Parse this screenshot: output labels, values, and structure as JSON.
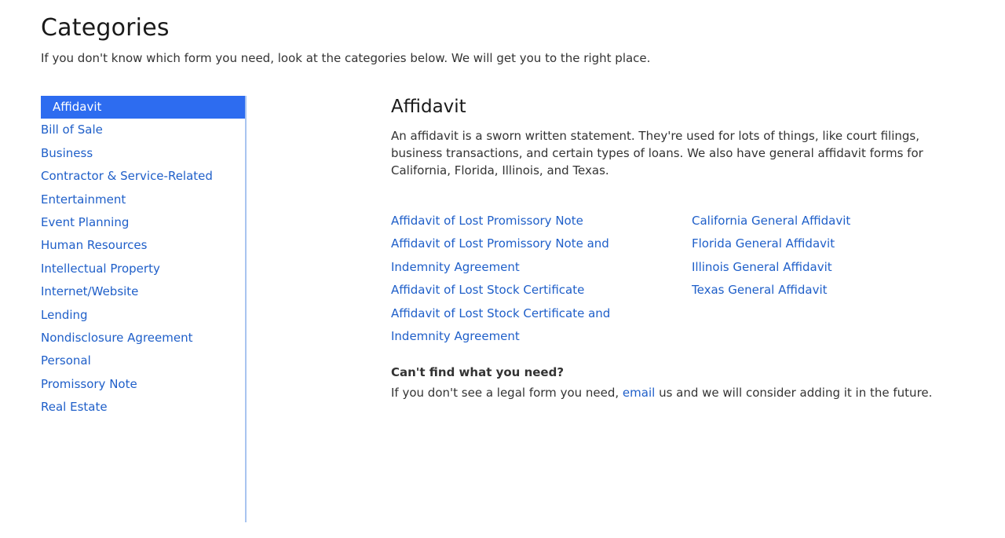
{
  "header": {
    "title": "Categories",
    "intro": "If you don't know which form you need, look at the categories below. We will get you to the right place."
  },
  "sidebar": {
    "items": [
      {
        "label": "Affidavit",
        "active": true
      },
      {
        "label": "Bill of Sale"
      },
      {
        "label": "Business"
      },
      {
        "label": "Contractor & Service-Related"
      },
      {
        "label": "Entertainment"
      },
      {
        "label": "Event Planning"
      },
      {
        "label": "Human Resources"
      },
      {
        "label": "Intellectual Property"
      },
      {
        "label": "Internet/Website"
      },
      {
        "label": "Lending"
      },
      {
        "label": "Nondisclosure Agreement"
      },
      {
        "label": "Personal"
      },
      {
        "label": "Promissory Note"
      },
      {
        "label": "Real Estate"
      }
    ]
  },
  "main": {
    "title": "Affidavit",
    "description": "An affidavit is a sworn written statement. They're used for lots of things, like court filings, business transactions, and certain types of loans. We also have general affidavit forms for California, Florida, Illinois, and Texas.",
    "forms_left": [
      "Affidavit of Lost Promissory Note",
      "Affidavit of Lost Promissory Note and Indemnity Agreement",
      "Affidavit of Lost Stock Certificate",
      "Affidavit of Lost Stock Certificate and Indemnity Agreement"
    ],
    "forms_right": [
      "California General Affidavit",
      "Florida General Affidavit",
      "Illinois General Affidavit",
      "Texas General Affidavit"
    ],
    "help": {
      "title": "Can't find what you need?",
      "text_before": "If you don't see a legal form you need, ",
      "link": "email",
      "text_after": " us and we will consider adding it in the future."
    }
  },
  "colors": {
    "accent": "#2d6cf0",
    "link": "#1f5fc9",
    "divider": "#a8c4f0"
  }
}
